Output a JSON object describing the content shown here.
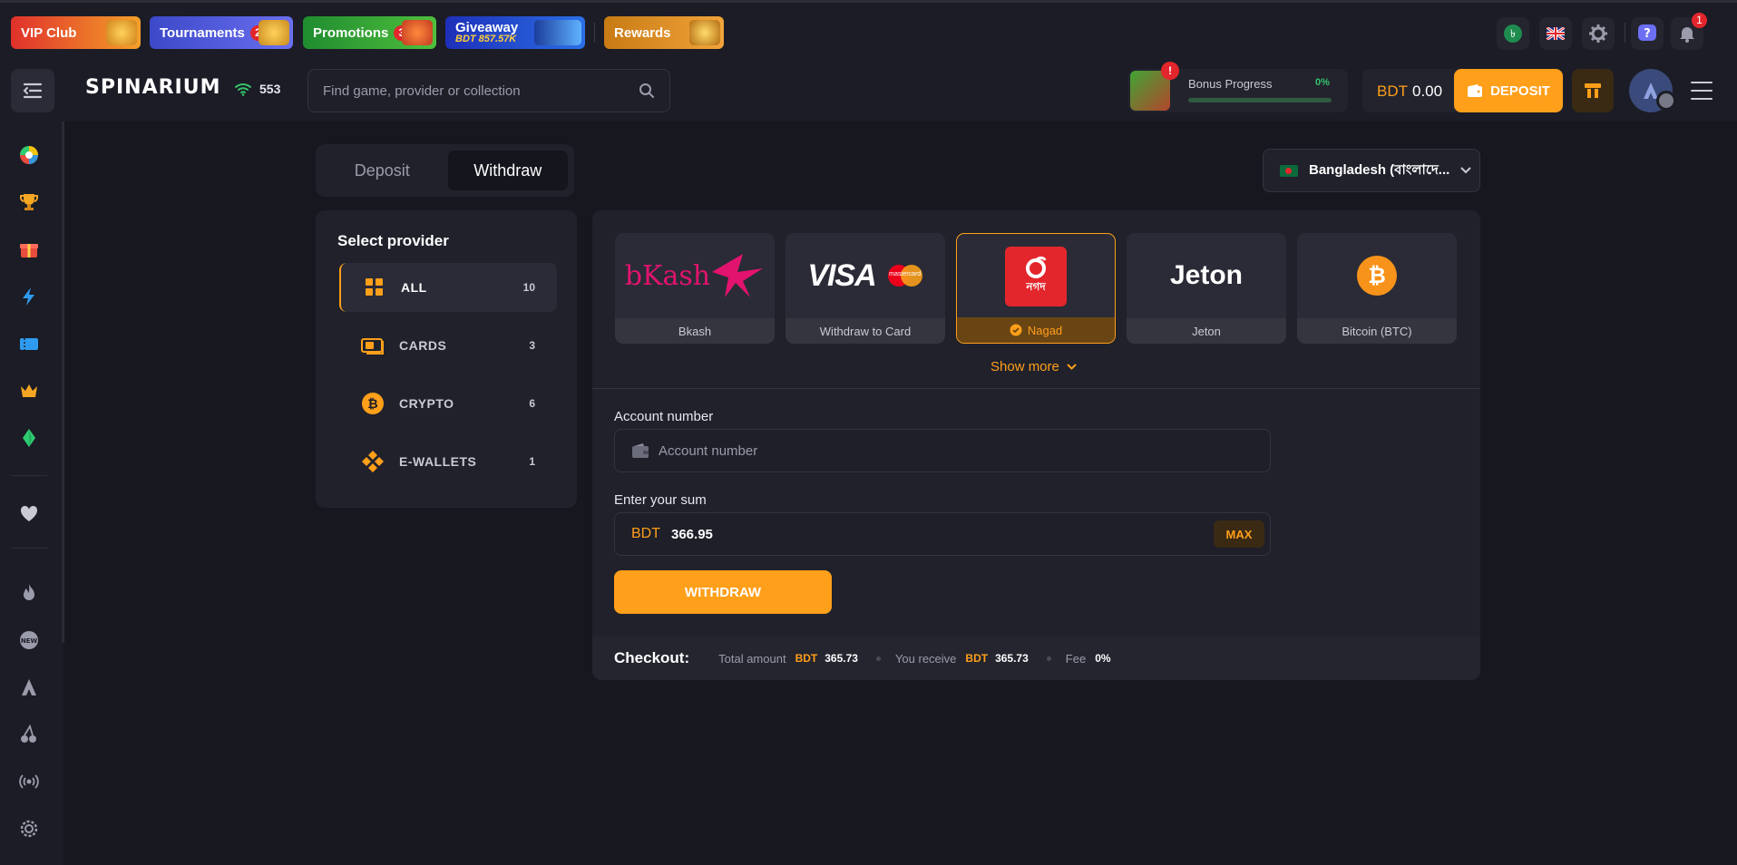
{
  "colors": {
    "accent": "#ff9f1a",
    "background": "#16171f",
    "panel": "#20212b",
    "success": "#35c46a",
    "alert": "#e3262c"
  },
  "promos": [
    {
      "label": "VIP Club",
      "icon": "crown-icon"
    },
    {
      "label": "Tournaments",
      "badge": "2",
      "icon": "trophy-icon"
    },
    {
      "label": "Promotions",
      "badge": "3",
      "icon": "gift-icon"
    },
    {
      "label": "Giveaway",
      "sub": "BDT 857.57K",
      "icon": "car-icon"
    },
    {
      "label": "Rewards",
      "icon": "treasure-icon"
    }
  ],
  "topbar": {
    "notifications_badge": "1",
    "icons": [
      "taka-currency-icon",
      "uk-flag-icon",
      "gear-icon",
      "help-icon",
      "bell-icon"
    ]
  },
  "header": {
    "logo": "SPINARIUM",
    "online_count": "553",
    "search_placeholder": "Find game, provider or collection",
    "bonus": {
      "label": "Bonus Progress",
      "percent": "0%",
      "progress": 0,
      "alert": "!"
    },
    "wallet": {
      "currency": "BDT",
      "amount": "0.00"
    },
    "deposit_label": "DEPOSIT"
  },
  "sidebar": {
    "icons": [
      "roulette-icon",
      "trophy-icon",
      "gift-icon",
      "lightning-icon",
      "ticket-icon",
      "crown-icon",
      "gem-icon",
      "heart-icon",
      "fire-icon",
      "new-icon",
      "spinarium-icon",
      "cherries-icon",
      "live-icon",
      "settings-icon"
    ]
  },
  "tabs": [
    {
      "label": "Deposit",
      "active": false
    },
    {
      "label": "Withdraw",
      "active": true
    }
  ],
  "country": {
    "label": "Bangladesh (বাংলাদে...",
    "icon": "bangladesh-flag-icon"
  },
  "providers": {
    "title": "Select provider",
    "items": [
      {
        "label": "ALL",
        "count": "10",
        "icon": "grid-icon",
        "active": true
      },
      {
        "label": "CARDS",
        "count": "3",
        "icon": "cards-icon",
        "active": false
      },
      {
        "label": "CRYPTO",
        "count": "6",
        "icon": "bitcoin-icon",
        "active": false
      },
      {
        "label": "E-WALLETS",
        "count": "1",
        "icon": "ewallet-icon",
        "active": false
      }
    ]
  },
  "methods": [
    {
      "name": "Bkash",
      "logo_text": "bKash"
    },
    {
      "name": "Withdraw to Card",
      "logo_text": "VISA",
      "logo_sub": "mastercard"
    },
    {
      "name": "Nagad",
      "logo_text": "নগদ",
      "selected": true
    },
    {
      "name": "Jeton",
      "logo_text": "Jeton"
    },
    {
      "name": "Bitcoin (BTC)",
      "logo_text": "₿"
    }
  ],
  "show_more": "Show more",
  "form": {
    "account_label": "Account number",
    "account_placeholder": "Account number",
    "sum_label": "Enter your sum",
    "sum_currency": "BDT",
    "sum_value": "366.95",
    "max_label": "MAX",
    "submit_label": "WITHDRAW"
  },
  "checkout": {
    "title": "Checkout:",
    "total_label": "Total amount",
    "total_currency": "BDT",
    "total_value": "365.73",
    "receive_label": "You receive",
    "receive_currency": "BDT",
    "receive_value": "365.73",
    "fee_label": "Fee",
    "fee_value": "0%"
  }
}
